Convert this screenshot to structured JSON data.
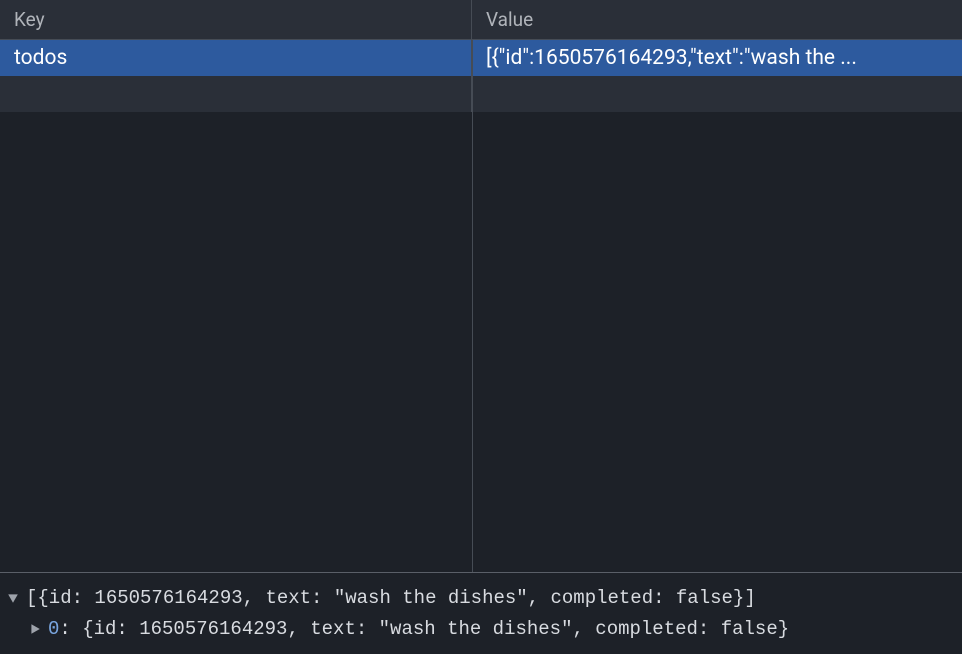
{
  "table": {
    "headers": {
      "key": "Key",
      "value": "Value"
    },
    "rows": [
      {
        "key": "todos",
        "value": "[{\"id\":1650576164293,\"text\":\"wash the ...",
        "selected": true
      }
    ]
  },
  "preview": {
    "line1": "[{id: 1650576164293, text: \"wash the dishes\", completed: false}]",
    "line2_key": "0",
    "line2_rest": ": {id: 1650576164293, text: \"wash the dishes\", completed: false}"
  }
}
